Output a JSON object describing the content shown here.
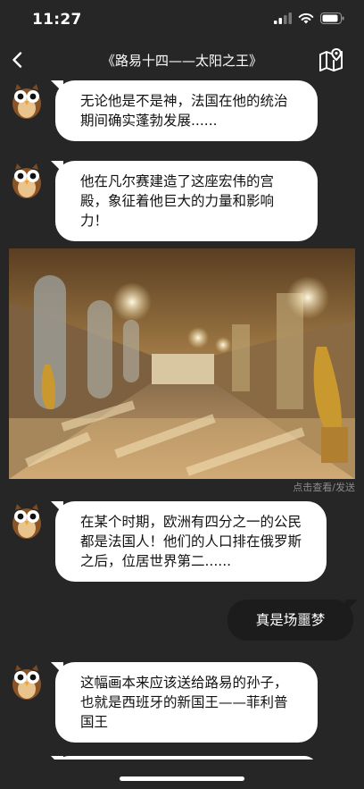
{
  "status_bar": {
    "time": "11:27"
  },
  "nav": {
    "title": "《路易十四——太阳之王》",
    "back_icon": "chevron-left-icon",
    "map_icon": "map-pin-icon"
  },
  "messages": [
    {
      "side": "left",
      "text": "无论他是不是神，法国在他的统治期间确实蓬勃发展......"
    },
    {
      "side": "left",
      "text": "他在凡尔赛建造了这座宏伟的宫殿，象征着他巨大的力量和影响力！"
    },
    {
      "side": "left",
      "type": "image",
      "caption": "点击查看/发送"
    },
    {
      "side": "left",
      "text": "在某个时期，欧洲有四分之一的公民都是法国人！他们的人口排在俄罗斯之后，位居世界第二......"
    },
    {
      "side": "right",
      "text": "真是场噩梦"
    },
    {
      "side": "left",
      "text": "这幅画本来应该送给路易的孙子，也就是西班牙的新国王——菲利普国王"
    }
  ],
  "colors": {
    "background": "#262626",
    "bubble_left": "#ffffff",
    "bubble_right": "#1c1c1c"
  }
}
